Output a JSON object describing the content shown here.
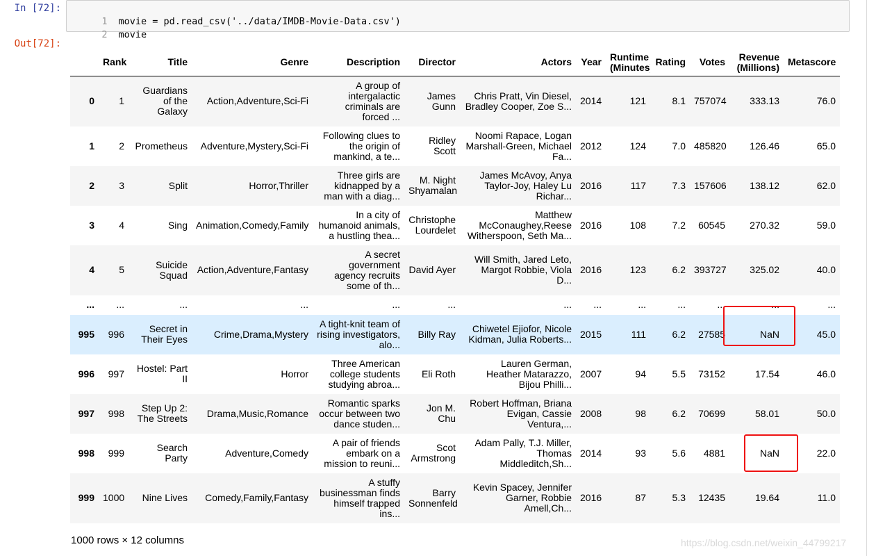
{
  "input_prompt": "In  [72]:",
  "output_prompt": "Out[72]:",
  "code_lines": [
    {
      "no": "1",
      "text": "movie = pd.read_csv('../data/IMDB-Movie-Data.csv')"
    },
    {
      "no": "2",
      "text": "movie"
    }
  ],
  "table": {
    "headers": [
      "",
      "Rank",
      "Title",
      "Genre",
      "Description",
      "Director",
      "Actors",
      "Year",
      "Runtime (Minutes)",
      "Rating",
      "Votes",
      "Revenue (Millions)",
      "Metascore"
    ],
    "rows": [
      {
        "idx": "0",
        "cells": [
          "1",
          "Guardians of the Galaxy",
          "Action,Adventure,Sci-Fi",
          "A group of intergalactic criminals are forced ...",
          "James Gunn",
          "Chris Pratt, Vin Diesel, Bradley Cooper, Zoe S...",
          "2014",
          "121",
          "8.1",
          "757074",
          "333.13",
          "76.0"
        ]
      },
      {
        "idx": "1",
        "cells": [
          "2",
          "Prometheus",
          "Adventure,Mystery,Sci-Fi",
          "Following clues to the origin of mankind, a te...",
          "Ridley Scott",
          "Noomi Rapace, Logan Marshall-Green, Michael Fa...",
          "2012",
          "124",
          "7.0",
          "485820",
          "126.46",
          "65.0"
        ]
      },
      {
        "idx": "2",
        "cells": [
          "3",
          "Split",
          "Horror,Thriller",
          "Three girls are kidnapped by a man with a diag...",
          "M. Night Shyamalan",
          "James McAvoy, Anya Taylor-Joy, Haley Lu Richar...",
          "2016",
          "117",
          "7.3",
          "157606",
          "138.12",
          "62.0"
        ]
      },
      {
        "idx": "3",
        "cells": [
          "4",
          "Sing",
          "Animation,Comedy,Family",
          "In a city of humanoid animals, a hustling thea...",
          "Christophe Lourdelet",
          "Matthew McConaughey,Reese Witherspoon, Seth Ma...",
          "2016",
          "108",
          "7.2",
          "60545",
          "270.32",
          "59.0"
        ]
      },
      {
        "idx": "4",
        "cells": [
          "5",
          "Suicide Squad",
          "Action,Adventure,Fantasy",
          "A secret government agency recruits some of th...",
          "David Ayer",
          "Will Smith, Jared Leto, Margot Robbie, Viola D...",
          "2016",
          "123",
          "6.2",
          "393727",
          "325.02",
          "40.0"
        ]
      },
      {
        "idx": "...",
        "cells": [
          "...",
          "...",
          "...",
          "...",
          "...",
          "...",
          "...",
          "...",
          "...",
          "...",
          "...",
          "..."
        ]
      },
      {
        "idx": "995",
        "cells": [
          "996",
          "Secret in Their Eyes",
          "Crime,Drama,Mystery",
          "A tight-knit team of rising investigators, alo...",
          "Billy Ray",
          "Chiwetel Ejiofor, Nicole Kidman, Julia Roberts...",
          "2015",
          "111",
          "6.2",
          "27585",
          "NaN",
          "45.0"
        ]
      },
      {
        "idx": "996",
        "cells": [
          "997",
          "Hostel: Part II",
          "Horror",
          "Three American college students studying abroa...",
          "Eli Roth",
          "Lauren German, Heather Matarazzo, Bijou Philli...",
          "2007",
          "94",
          "5.5",
          "73152",
          "17.54",
          "46.0"
        ]
      },
      {
        "idx": "997",
        "cells": [
          "998",
          "Step Up 2: The Streets",
          "Drama,Music,Romance",
          "Romantic sparks occur between two dance studen...",
          "Jon M. Chu",
          "Robert Hoffman, Briana Evigan, Cassie Ventura,...",
          "2008",
          "98",
          "6.2",
          "70699",
          "58.01",
          "50.0"
        ]
      },
      {
        "idx": "998",
        "cells": [
          "999",
          "Search Party",
          "Adventure,Comedy",
          "A pair of friends embark on a mission to reuni...",
          "Scot Armstrong",
          "Adam Pally, T.J. Miller, Thomas Middleditch,Sh...",
          "2014",
          "93",
          "5.6",
          "4881",
          "NaN",
          "22.0"
        ]
      },
      {
        "idx": "999",
        "cells": [
          "1000",
          "Nine Lives",
          "Comedy,Family,Fantasy",
          "A stuffy businessman finds himself trapped ins...",
          "Barry Sonnenfeld",
          "Kevin Spacey, Jennifer Garner, Robbie Amell,Ch...",
          "2016",
          "87",
          "5.3",
          "12435",
          "19.64",
          "11.0"
        ]
      }
    ]
  },
  "footer": "1000 rows × 12 columns",
  "watermark": "https://blog.csdn.net/weixin_44799217",
  "colors": {
    "highlight_row": "#daeefe",
    "annotation_box": "#ee1111"
  }
}
